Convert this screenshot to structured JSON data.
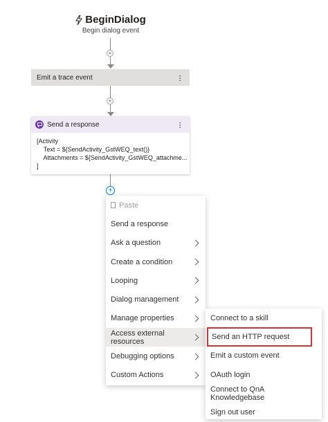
{
  "trigger": {
    "title": "BeginDialog",
    "subtitle": "Begin dialog event",
    "icon": "lightning-icon"
  },
  "nodes": {
    "trace": {
      "label": "Emit a trace event"
    },
    "response": {
      "label": "Send a response",
      "body": [
        "[Activity",
        "    Text = ${SendActivity_GstWEQ_text()}",
        "    Attachments = ${SendActivity_GstWEQ_attachme...",
        "]"
      ]
    }
  },
  "menu": {
    "items": [
      {
        "label": "Paste",
        "disabled": true,
        "submenu": false
      },
      {
        "label": "Send a response",
        "submenu": false
      },
      {
        "label": "Ask a question",
        "submenu": true
      },
      {
        "label": "Create a condition",
        "submenu": true
      },
      {
        "label": "Looping",
        "submenu": true
      },
      {
        "label": "Dialog management",
        "submenu": true
      },
      {
        "label": "Manage properties",
        "submenu": true
      },
      {
        "label": "Access external resources",
        "submenu": true,
        "active": true
      },
      {
        "label": "Debugging options",
        "submenu": true
      },
      {
        "label": "Custom Actions",
        "submenu": true
      }
    ]
  },
  "submenu": {
    "items": [
      {
        "label": "Connect to a skill"
      },
      {
        "label": "Send an HTTP request",
        "highlighted": true
      },
      {
        "label": "Emit a custom event"
      },
      {
        "label": "OAuth login"
      },
      {
        "label": "Connect to QnA Knowledgebase"
      },
      {
        "label": "Sign out user"
      }
    ]
  },
  "colors": {
    "accent": "#0078d4",
    "highlight_border": "#d13438",
    "response_header": "#efe9f5",
    "trace_bg": "#e1dfdd"
  }
}
